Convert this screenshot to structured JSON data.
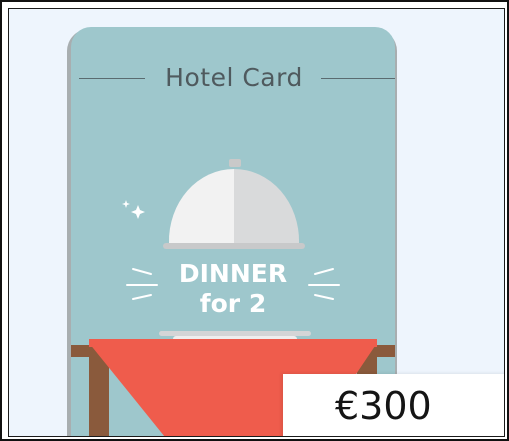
{
  "card": {
    "title": "Hotel Card",
    "offer_line1": "DINNER",
    "offer_line2": "for 2",
    "price": "€300"
  },
  "colors": {
    "card_bg": "#9ec7cc",
    "tablecloth": "#ef5c4c",
    "table_wood": "#8a5a3c",
    "cloche_light": "#f2f2f2",
    "cloche_shadow": "#d9dadb",
    "panel_bg": "#eef5fd"
  },
  "icons": [
    "sparkle-icon",
    "cloche-icon",
    "plate-icon",
    "table-icon"
  ]
}
